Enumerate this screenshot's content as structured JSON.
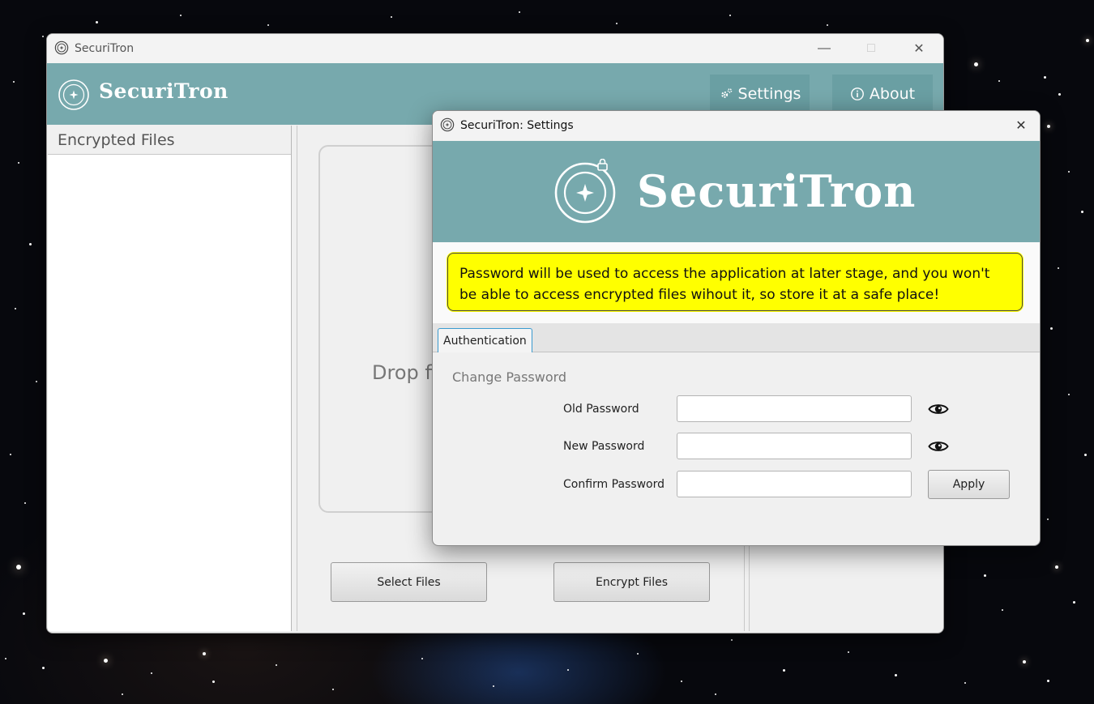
{
  "main_window": {
    "title": "SecuriTron",
    "brand": "SecuriTron",
    "header_buttons": {
      "settings": "Settings",
      "about": "About"
    },
    "sidebar_title": "Encrypted Files",
    "drop_zone_text": "Drop fi",
    "buttons": {
      "select_files": "Select Files",
      "encrypt_files": "Encrypt Files"
    }
  },
  "settings_dialog": {
    "title": "SecuriTron: Settings",
    "brand": "SecuriTron",
    "warning": "Password will be used to access the application at later stage, and you won't be able to access encrypted files wihout it, so store it at a safe place!",
    "tabs": [
      {
        "label": "Authentication",
        "selected": true
      }
    ],
    "section_title": "Change Password",
    "fields": {
      "old_password": {
        "label": "Old Password",
        "value": ""
      },
      "new_password": {
        "label": "New Password",
        "value": ""
      },
      "confirm_password": {
        "label": "Confirm Password",
        "value": ""
      }
    },
    "apply_label": "Apply"
  },
  "icons": {
    "app": "securitron-logo-icon",
    "settings": "gears-icon",
    "about": "info-icon",
    "reveal": "eye-icon",
    "close": "close-icon",
    "minimize": "minimize-icon",
    "maximize": "maximize-icon"
  },
  "colors": {
    "header_teal": "#77a9ad",
    "header_button": "#6a9fa3",
    "warning_yellow": "#ffff00",
    "tab_border_blue": "#3a9bd0"
  }
}
